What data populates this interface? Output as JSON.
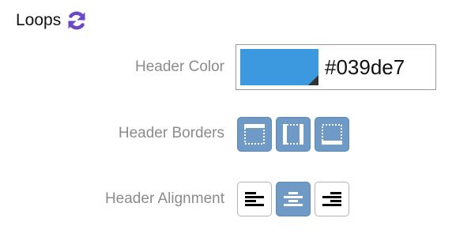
{
  "section": {
    "title": "Loops",
    "icon": "refresh-icon",
    "icon_color": "#6b48c8"
  },
  "header_color": {
    "label": "Header Color",
    "value": "#039de7",
    "swatch_color": "#3d99df"
  },
  "header_borders": {
    "label": "Header Borders",
    "options": [
      {
        "icon": "border-top-icon",
        "selected": true
      },
      {
        "icon": "border-sides-icon",
        "selected": true
      },
      {
        "icon": "border-bottom-icon",
        "selected": true
      }
    ]
  },
  "header_alignment": {
    "label": "Header Alignment",
    "selected": "center",
    "options": [
      {
        "icon": "align-left-icon",
        "selected": false
      },
      {
        "icon": "align-center-icon",
        "selected": true
      },
      {
        "icon": "align-right-icon",
        "selected": false
      }
    ]
  },
  "colors": {
    "selected_button": "#6f9ac6",
    "label_text": "#8b8b8b"
  }
}
